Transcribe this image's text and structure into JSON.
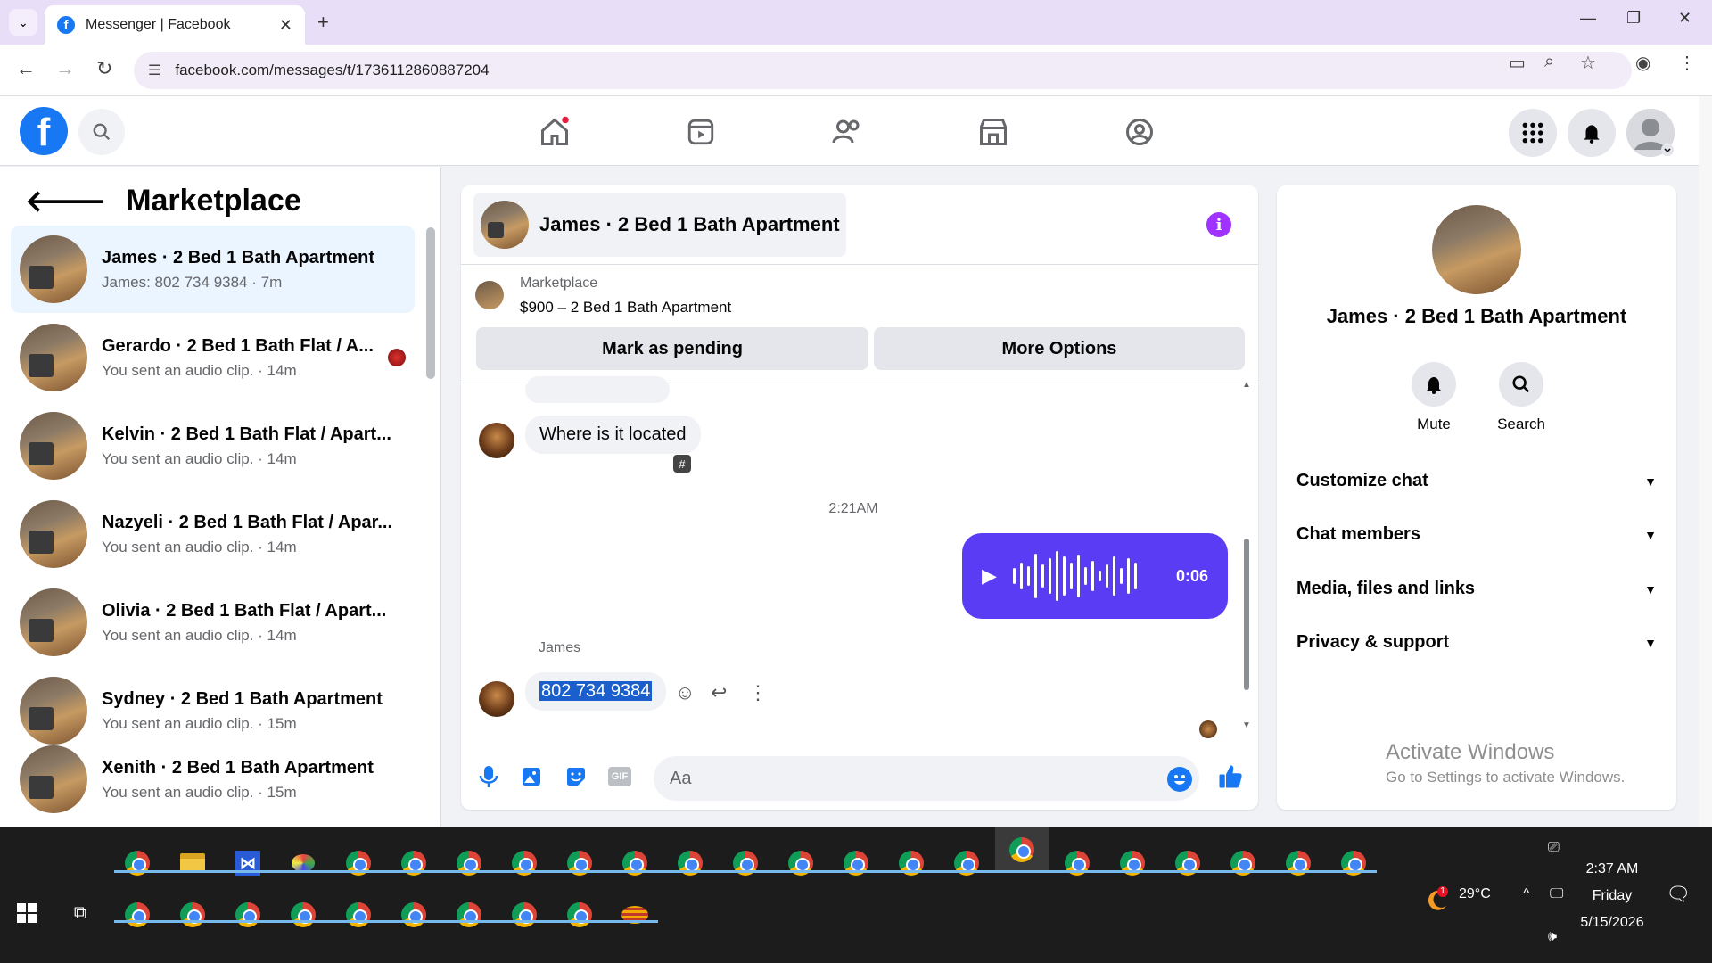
{
  "browser": {
    "tab_title": "Messenger | Facebook",
    "url": "facebook.com/messages/t/1736112860887204"
  },
  "sidebar": {
    "title": "Marketplace",
    "conversations": [
      {
        "name": "James · 2 Bed 1 Bath Apartment",
        "preview": "James: 802 734 9384 · 7m"
      },
      {
        "name": "Gerardo · 2 Bed 1 Bath Flat / A...",
        "preview": "You sent an audio clip. · 14m"
      },
      {
        "name": "Kelvin · 2 Bed 1 Bath Flat / Apart...",
        "preview": "You sent an audio clip. · 14m"
      },
      {
        "name": "Nazyeli · 2 Bed 1 Bath Flat / Apar...",
        "preview": "You sent an audio clip. · 14m"
      },
      {
        "name": "Olivia · 2 Bed 1 Bath Flat / Apart...",
        "preview": "You sent an audio clip. · 14m"
      },
      {
        "name": "Sydney · 2 Bed 1 Bath Apartment",
        "preview": "You sent an audio clip. · 15m"
      },
      {
        "name": "Xenith · 2 Bed 1 Bath Apartment",
        "preview": "You sent an audio clip. · 15m"
      }
    ]
  },
  "chat": {
    "header_name": "James · 2 Bed 1 Bath Apartment",
    "marketplace_label": "Marketplace",
    "listing": "$900 – 2 Bed 1 Bath Apartment",
    "btn_pending": "Mark as pending",
    "btn_more": "More Options",
    "msg_located": "Where is it located",
    "timestamp": "2:21AM",
    "audio_duration": "0:06",
    "sender_name": "James",
    "phone_msg": "802 734 9384",
    "composer_placeholder": "Aa"
  },
  "right_panel": {
    "name": "James · 2 Bed 1 Bath Apartment",
    "mute_label": "Mute",
    "search_label": "Search",
    "sections": [
      "Customize chat",
      "Chat members",
      "Media, files and links",
      "Privacy & support"
    ],
    "watermark_title": "Activate Windows",
    "watermark_sub": "Go to Settings to activate Windows."
  },
  "taskbar": {
    "time": "2:37 AM",
    "day": "Friday",
    "date": "5/15/2026",
    "weather": "29°C",
    "weather_badge": "1"
  },
  "colors": {
    "fb_blue": "#1877f2",
    "audio_bubble": "#5b3cf5",
    "info_purple": "#a033ff"
  }
}
